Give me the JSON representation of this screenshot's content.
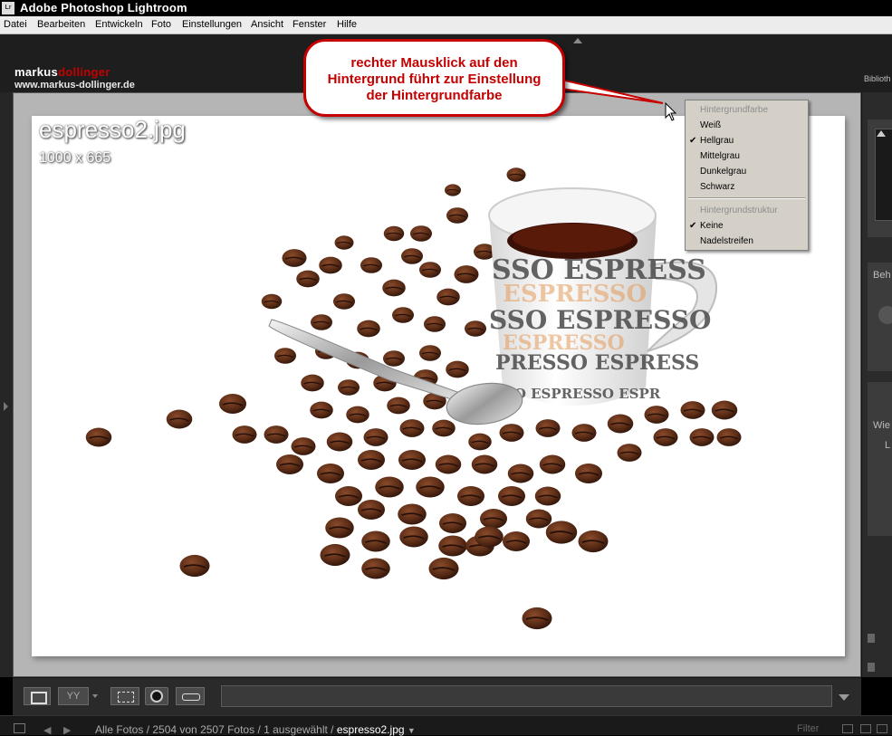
{
  "window": {
    "title": "Adobe Photoshop Lightroom",
    "app_icon": "Lr"
  },
  "menu": [
    "Datei",
    "Bearbeiten",
    "Entwickeln",
    "Foto",
    "Einstellungen",
    "Ansicht",
    "Fenster",
    "Hilfe"
  ],
  "header": {
    "logo_part1": "markus",
    "logo_part2": "dollinger",
    "url": "www.markus-dollinger.de",
    "module_label": "Biblioth"
  },
  "photo": {
    "filename": "espresso2.jpg",
    "dimensions": "1000 x 665",
    "mug_text_1": "SSO ESPRESS",
    "mug_text_2": "SSO ESPRESSO",
    "mug_text_3": "PRESSO ESPRESS",
    "mug_text_4": "SO ESPRESSO ESPR"
  },
  "callout": {
    "line1": "rechter Mausklick auf den",
    "line2": "Hintergrund führt zur Einstellung",
    "line3": "der Hintergrundfarbe"
  },
  "context_menu": {
    "header1": "Hintergrundfarbe",
    "colors": [
      {
        "label": "Weiß",
        "checked": false
      },
      {
        "label": "Hellgrau",
        "checked": true
      },
      {
        "label": "Mittelgrau",
        "checked": false
      },
      {
        "label": "Dunkelgrau",
        "checked": false
      },
      {
        "label": "Schwarz",
        "checked": false
      }
    ],
    "header2": "Hintergrundstruktur",
    "structures": [
      {
        "label": "Keine",
        "checked": true
      },
      {
        "label": "Nadelstreifen",
        "checked": false
      }
    ],
    "check_glyph": "✔"
  },
  "right_panel": {
    "label1": "Beh",
    "label2": "Wie",
    "label3": "L"
  },
  "status": {
    "breadcrumb": "Alle Fotos / 2504 von 2507 Fotos / 1 ausgewählt / ",
    "current_file": "espresso2.jpg",
    "filter": "Filter"
  },
  "colors": {
    "accent_red": "#c40000",
    "background_lightgray": "#b5b5b5"
  }
}
